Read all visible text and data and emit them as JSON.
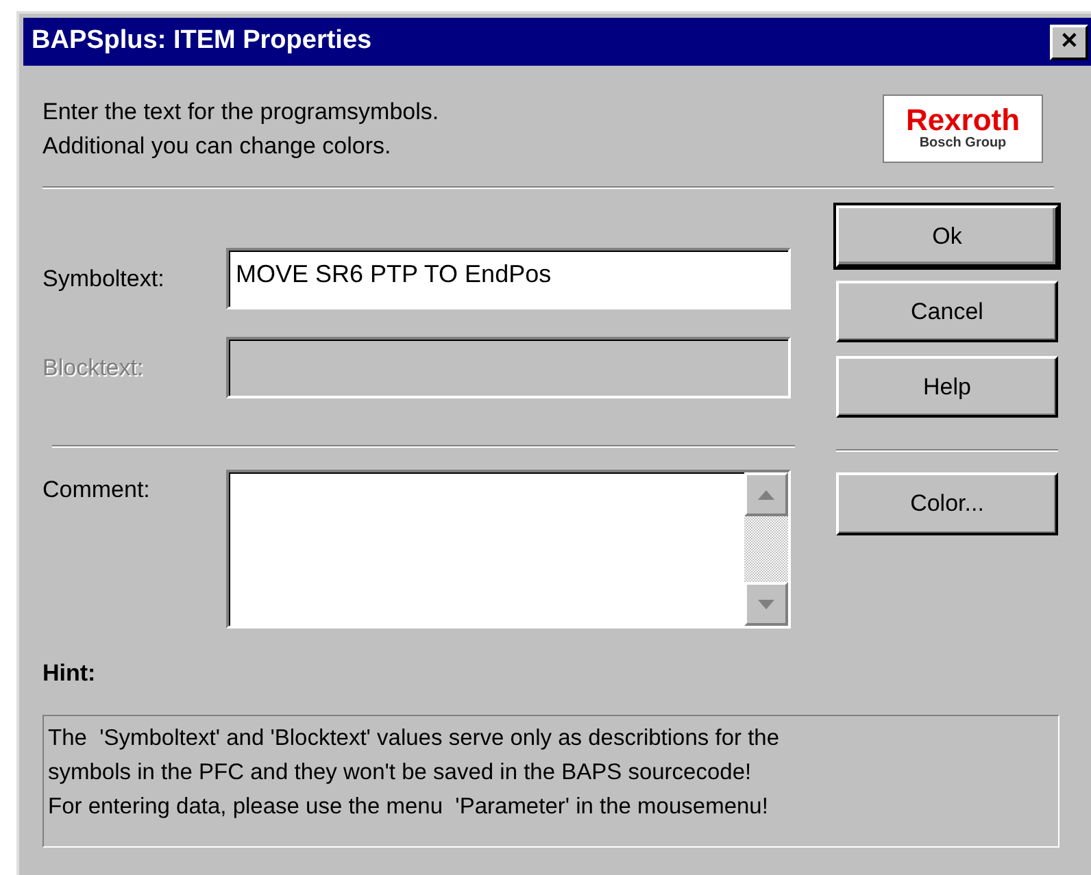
{
  "window": {
    "title": "BAPSplus: ITEM Properties",
    "close_glyph": "✕"
  },
  "intro": [
    "Enter the text for the programsymbols.",
    "Additional you can change colors."
  ],
  "logo": {
    "name": "Rexroth",
    "tagline": "Bosch Group"
  },
  "fields": [
    {
      "label": "Symboltext:",
      "value": "MOVE SR6 PTP TO EndPos",
      "disabled": false
    },
    {
      "label": "Blocktext:",
      "disabled": true
    }
  ],
  "comment": {
    "label": "Comment:"
  },
  "buttons": [
    {
      "label": "Ok",
      "default": true
    },
    {
      "label": "Cancel",
      "default": false
    },
    {
      "label": "Help",
      "default": false
    }
  ],
  "color_button": {
    "label": "Color..."
  },
  "hint": {
    "title": "Hint:",
    "lines": [
      "The  'Symboltext' and 'Blocktext' values serve only as describtions for the",
      "symbols in the PFC and they won't be saved in the BAPS sourcecode!",
      "For entering data, please use the menu  'Parameter' in the mousemenu!"
    ]
  }
}
